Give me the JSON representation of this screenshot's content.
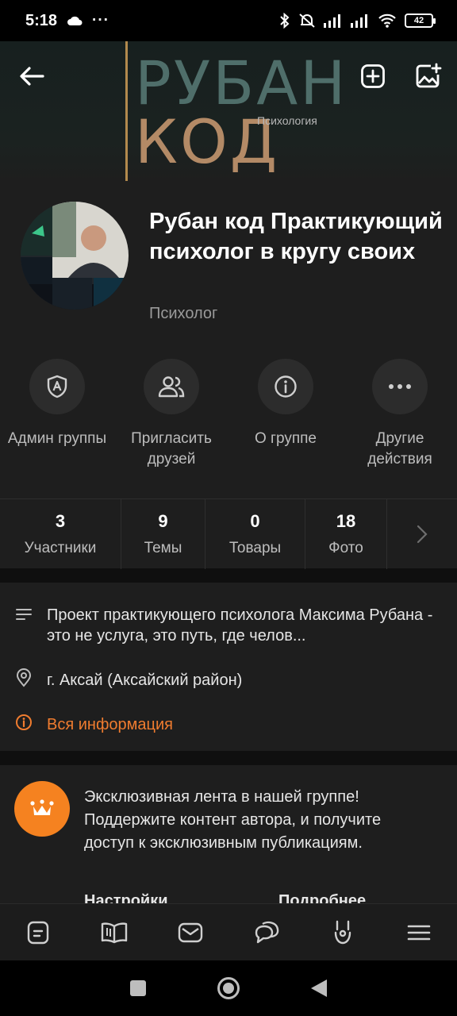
{
  "status_bar": {
    "time": "5:18",
    "battery": "42"
  },
  "cover": {
    "word1": "РУБАН",
    "word2": "КОД",
    "subtitle": "Психология"
  },
  "group": {
    "title": "Рубан код Практикующий психолог в кругу своих",
    "category": "Психолог"
  },
  "actions": [
    {
      "label": "Админ группы",
      "icon": "admin-shield-icon"
    },
    {
      "label": "Пригласить друзей",
      "icon": "invite-friends-icon"
    },
    {
      "label": "О группе",
      "icon": "info-icon"
    },
    {
      "label": "Другие действия",
      "icon": "more-icon"
    }
  ],
  "stats": [
    {
      "value": "3",
      "label": "Участники"
    },
    {
      "value": "9",
      "label": "Темы"
    },
    {
      "value": "0",
      "label": "Товары"
    },
    {
      "value": "18",
      "label": "Фото"
    }
  ],
  "info": {
    "description": "Проект практикующего психолога Максима Рубана  -  это не услуга, это путь, где челов...",
    "location": "г. Аксай (Аксайский район)",
    "all_info": "Вся информация"
  },
  "promo": {
    "text": "Эксклюзивная лента в нашей группе! Поддержите контент автора, и получите доступ к эксклюзивным публикациям.",
    "settings": "Настройки",
    "more": "Подробнее"
  },
  "colors": {
    "accent": "#f07c2f",
    "crown_bg": "#f58220",
    "background": "#1e1e1e"
  }
}
